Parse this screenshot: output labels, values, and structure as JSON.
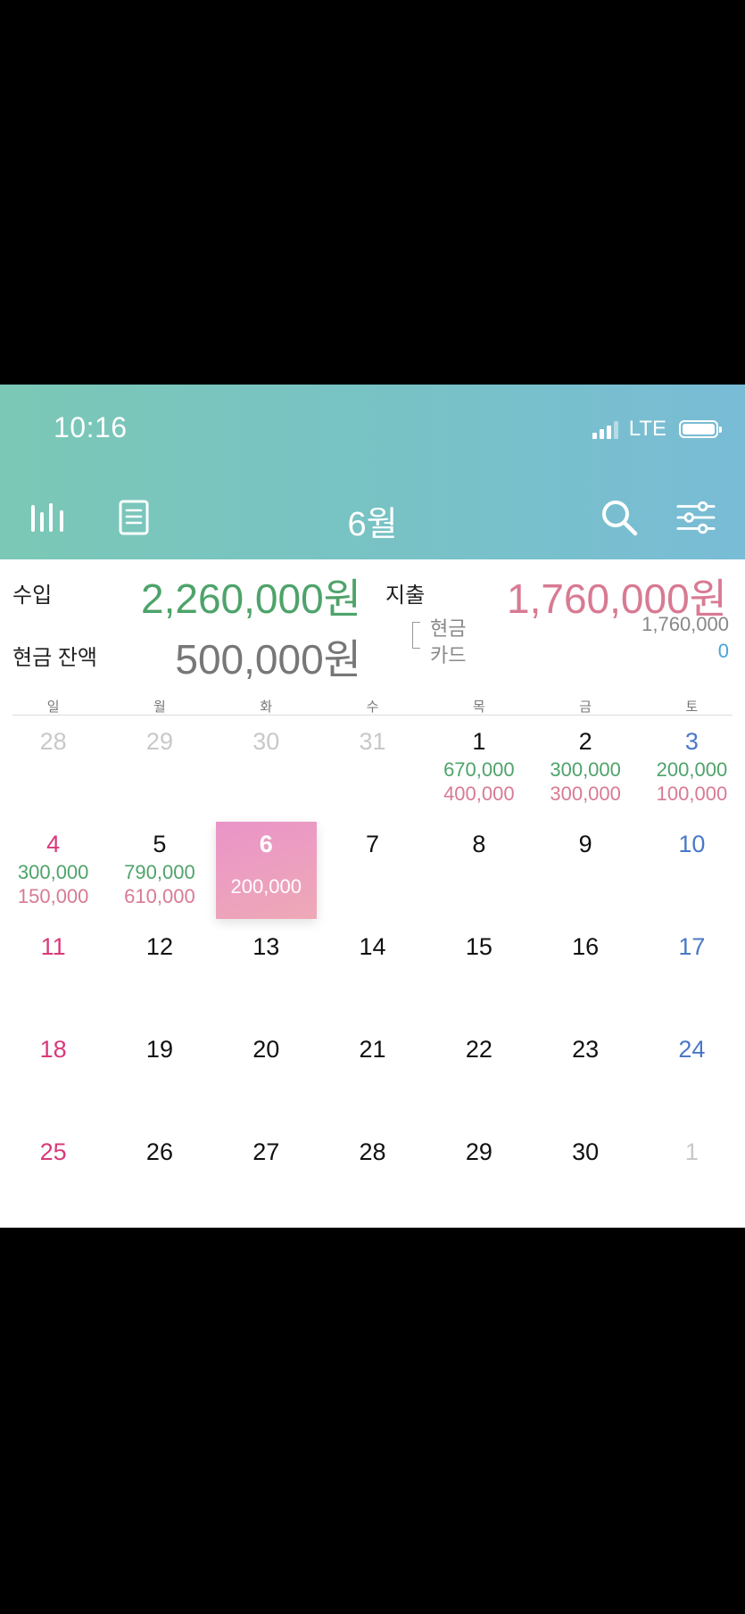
{
  "status_bar": {
    "time": "10:16",
    "network": "LTE"
  },
  "header": {
    "title": "6월",
    "icons": [
      "stats-icon",
      "list-icon",
      "search-icon",
      "filter-icon"
    ]
  },
  "summary": {
    "income_label": "수입",
    "income_value": "2,260,000원",
    "expense_label": "지출",
    "expense_value": "1,760,000원",
    "cash_balance_label": "현금 잔액",
    "cash_balance_value": "500,000원",
    "cash_label": "현금",
    "cash_value": "1,760,000",
    "card_label": "카드",
    "card_value": "0"
  },
  "weekdays": [
    "일",
    "월",
    "화",
    "수",
    "목",
    "금",
    "토"
  ],
  "days": [
    {
      "day": "28",
      "type": "muted"
    },
    {
      "day": "29",
      "type": "muted"
    },
    {
      "day": "30",
      "type": "muted"
    },
    {
      "day": "31",
      "type": "muted"
    },
    {
      "day": "1",
      "income": "670,000",
      "expense": "400,000"
    },
    {
      "day": "2",
      "income": "300,000",
      "expense": "300,000"
    },
    {
      "day": "3",
      "type": "sat",
      "income": "200,000",
      "expense": "100,000"
    },
    {
      "day": "4",
      "type": "sun",
      "income": "300,000",
      "expense": "150,000"
    },
    {
      "day": "5",
      "income": "790,000",
      "expense": "610,000"
    },
    {
      "day": "6",
      "type": "selected",
      "expense": "200,000"
    },
    {
      "day": "7"
    },
    {
      "day": "8"
    },
    {
      "day": "9"
    },
    {
      "day": "10",
      "type": "sat"
    },
    {
      "day": "11",
      "type": "sun"
    },
    {
      "day": "12"
    },
    {
      "day": "13"
    },
    {
      "day": "14"
    },
    {
      "day": "15"
    },
    {
      "day": "16"
    },
    {
      "day": "17",
      "type": "sat"
    },
    {
      "day": "18",
      "type": "sun"
    },
    {
      "day": "19"
    },
    {
      "day": "20"
    },
    {
      "day": "21"
    },
    {
      "day": "22"
    },
    {
      "day": "23"
    },
    {
      "day": "24",
      "type": "sat"
    },
    {
      "day": "25",
      "type": "sun"
    },
    {
      "day": "26"
    },
    {
      "day": "27"
    },
    {
      "day": "28"
    },
    {
      "day": "29"
    },
    {
      "day": "30"
    },
    {
      "day": "1",
      "type": "muted"
    }
  ],
  "colors": {
    "income": "#4ea36a",
    "expense": "#d87a93",
    "sunday": "#d9397a",
    "saturday": "#4a78c7",
    "card": "#4aa3d9"
  }
}
